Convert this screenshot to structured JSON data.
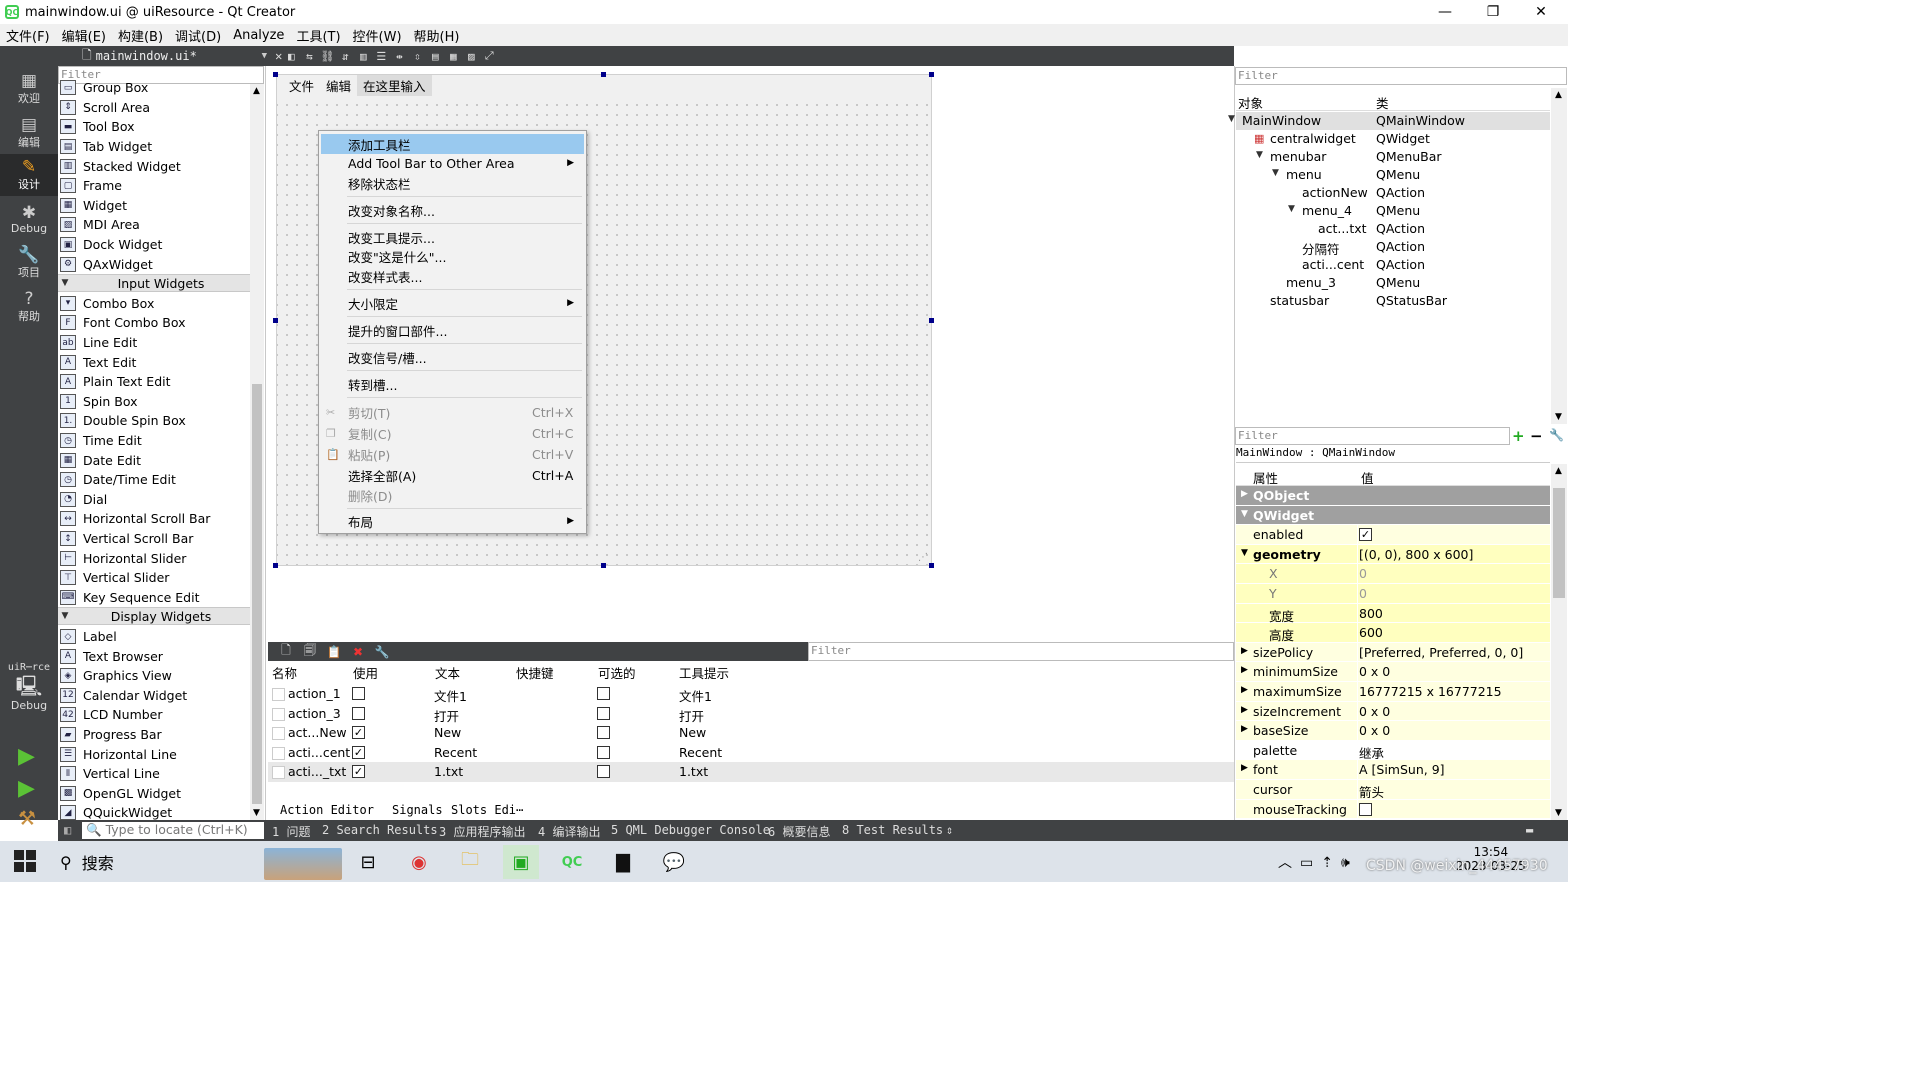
{
  "window": {
    "title": "mainwindow.ui @ uiResource - Qt Creator",
    "app_icon_text": "QC",
    "minimize": "—",
    "maximize": "❐",
    "close": "✕"
  },
  "menubar": [
    "文件(F)",
    "编辑(E)",
    "构建(B)",
    "调试(D)",
    "Analyze",
    "工具(T)",
    "控件(W)",
    "帮助(H)"
  ],
  "modes": [
    {
      "label": "欢迎",
      "icon": "▦"
    },
    {
      "label": "编辑",
      "icon": "▤"
    },
    {
      "label": "设计",
      "icon": "✎"
    },
    {
      "label": "Debug",
      "icon": "✱"
    },
    {
      "label": "项目",
      "icon": "🔧"
    },
    {
      "label": "帮助",
      "icon": "?"
    }
  ],
  "kit": {
    "project": "uiR⋯rce",
    "config": "Debug"
  },
  "editor_toolbar": {
    "file": "mainwindow.ui*",
    "close": "✕"
  },
  "widgetbox": {
    "filter_placeholder": "Filter",
    "items_top": [
      "Group Box",
      "Scroll Area",
      "Tool Box",
      "Tab Widget",
      "Stacked Widget",
      "Frame",
      "Widget",
      "MDI Area",
      "Dock Widget",
      "QAxWidget"
    ],
    "cat_input": "Input Widgets",
    "items_input": [
      "Combo Box",
      "Font Combo Box",
      "Line Edit",
      "Text Edit",
      "Plain Text Edit",
      "Spin Box",
      "Double Spin Box",
      "Time Edit",
      "Date Edit",
      "Date/Time Edit",
      "Dial",
      "Horizontal Scroll Bar",
      "Vertical Scroll Bar",
      "Horizontal Slider",
      "Vertical Slider",
      "Key Sequence Edit"
    ],
    "cat_display": "Display Widgets",
    "items_display": [
      "Label",
      "Text Browser",
      "Graphics View",
      "Calendar Widget",
      "LCD Number",
      "Progress Bar",
      "Horizontal Line",
      "Vertical Line",
      "OpenGL Widget",
      "QQuickWidget"
    ]
  },
  "form": {
    "menu": [
      "文件",
      "编辑"
    ],
    "type_here": "在这里输入"
  },
  "context_menu": {
    "add_toolbar": "添加工具栏",
    "add_toolbar_other": "Add Tool Bar to Other Area",
    "remove_statusbar": "移除状态栏",
    "change_object_name": "改变对象名称...",
    "change_tooltip": "改变工具提示...",
    "change_whats_this": "改变\"这是什么\"...",
    "change_stylesheet": "改变样式表...",
    "size_constraints": "大小限定",
    "promote": "提升的窗口部件...",
    "signals_slots": "改变信号/槽...",
    "goto_slot": "转到槽...",
    "cut": "剪切(T)",
    "cut_sc": "Ctrl+X",
    "copy": "复制(C)",
    "copy_sc": "Ctrl+C",
    "paste": "粘贴(P)",
    "paste_sc": "Ctrl+V",
    "select_all": "选择全部(A)",
    "select_all_sc": "Ctrl+A",
    "delete": "删除(D)",
    "layout": "布局"
  },
  "action_editor": {
    "filter_placeholder": "Filter",
    "headers": {
      "name": "名称",
      "used": "使用",
      "text": "文本",
      "shortcut": "快捷键",
      "checkable": "可选的",
      "tooltip": "工具提示"
    },
    "rows": [
      {
        "name": "action_1",
        "used": false,
        "text": "文件1",
        "checkable": false,
        "tooltip": "文件1"
      },
      {
        "name": "action_3",
        "used": false,
        "text": "打开",
        "checkable": false,
        "tooltip": "打开"
      },
      {
        "name": "act...New",
        "used": true,
        "text": "New",
        "checkable": false,
        "tooltip": "New"
      },
      {
        "name": "acti...cent",
        "used": true,
        "text": "Recent",
        "checkable": false,
        "tooltip": "Recent"
      },
      {
        "name": "acti..._txt",
        "used": true,
        "text": "1.txt",
        "checkable": false,
        "tooltip": "1.txt"
      }
    ],
    "tabs": [
      "Action Editor",
      "Signals",
      "Slots Edi⋯"
    ]
  },
  "object_inspector": {
    "filter_placeholder": "Filter",
    "header_object": "对象",
    "header_class": "类",
    "rows": [
      {
        "name": "MainWindow",
        "cls": "QMainWindow"
      },
      {
        "name": "centralwidget",
        "cls": "QWidget"
      },
      {
        "name": "menubar",
        "cls": "QMenuBar"
      },
      {
        "name": "menu",
        "cls": "QMenu"
      },
      {
        "name": "actionNew",
        "cls": "QAction"
      },
      {
        "name": "menu_4",
        "cls": "QMenu"
      },
      {
        "name": "act...txt",
        "cls": "QAction"
      },
      {
        "name": "分隔符",
        "cls": "QAction"
      },
      {
        "name": "acti...cent",
        "cls": "QAction"
      },
      {
        "name": "menu_3",
        "cls": "QMenu"
      },
      {
        "name": "statusbar",
        "cls": "QStatusBar"
      }
    ]
  },
  "property_editor": {
    "filter_placeholder": "Filter",
    "context": "MainWindow : QMainWindow",
    "header_prop": "属性",
    "header_value": "值",
    "rows": [
      {
        "name": "QObject",
        "value": ""
      },
      {
        "name": "QWidget",
        "value": ""
      },
      {
        "name": "enabled",
        "value": "✓"
      },
      {
        "name": "geometry",
        "value": "[(0, 0), 800 x 600]"
      },
      {
        "name": "X",
        "value": "0"
      },
      {
        "name": "Y",
        "value": "0"
      },
      {
        "name": "宽度",
        "value": "800"
      },
      {
        "name": "高度",
        "value": "600"
      },
      {
        "name": "sizePolicy",
        "value": "[Preferred, Preferred, 0, 0]"
      },
      {
        "name": "minimumSize",
        "value": "0 x 0"
      },
      {
        "name": "maximumSize",
        "value": "16777215 x 16777215"
      },
      {
        "name": "sizeIncrement",
        "value": "0 x 0"
      },
      {
        "name": "baseSize",
        "value": "0 x 0"
      },
      {
        "name": "palette",
        "value": "继承"
      },
      {
        "name": "font",
        "value": "A  [SimSun, 9]"
      },
      {
        "name": "cursor",
        "value": "箭头"
      },
      {
        "name": "mouseTracking",
        "value": ""
      }
    ]
  },
  "statusbar": {
    "locate_placeholder": "Type to locate (Ctrl+K)",
    "panes": [
      "1 问题",
      "2 Search Results",
      "3 应用程序输出",
      "4 编译输出",
      "5 QML Debugger Console",
      "6 概要信息",
      "8 Test Results"
    ]
  },
  "taskbar": {
    "search": "搜索",
    "time": "13:54",
    "date": "2023-03-25",
    "watermark": "CSDN @weixin_44457930"
  }
}
